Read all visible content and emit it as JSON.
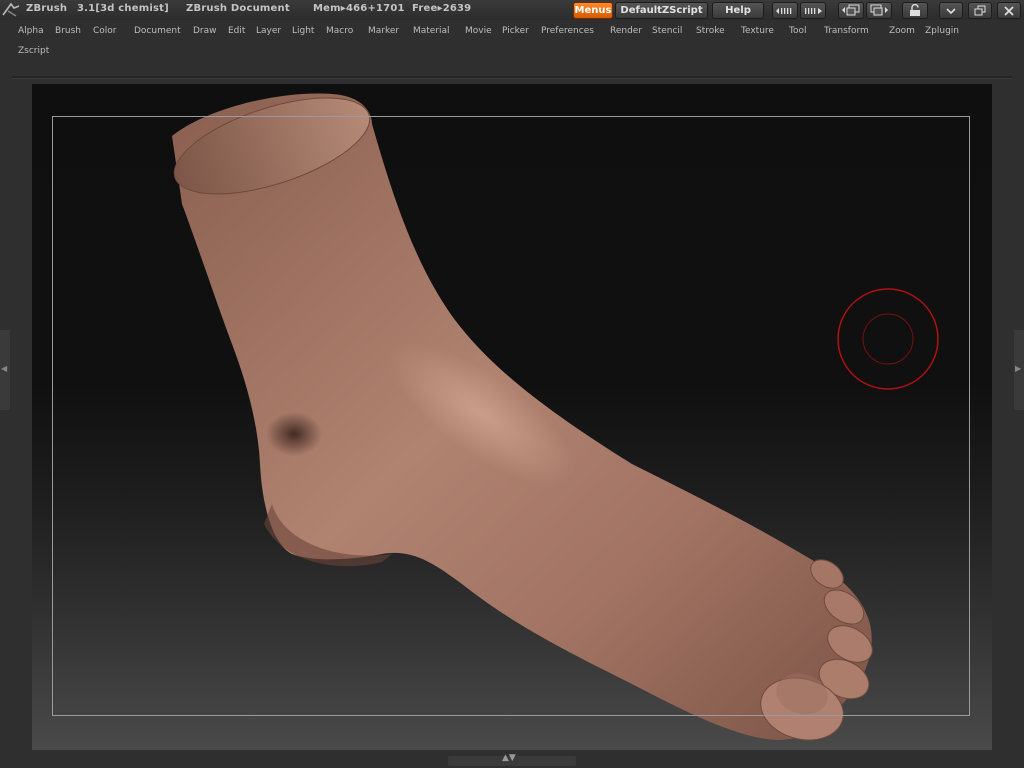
{
  "titlebar": {
    "app_name": "ZBrush",
    "version": "3.1[3d chemist]",
    "document": "ZBrush Document",
    "mem_label": "Mem▸466+1701",
    "free_label": "Free▸2639",
    "menus_btn": "Menus",
    "script_btn": "DefaultZScript",
    "help_btn": "Help"
  },
  "menu": {
    "items": [
      "Alpha",
      "Brush",
      "Color",
      "Document",
      "Draw",
      "Edit",
      "Layer",
      "Light",
      "Macro",
      "Marker",
      "Material",
      "Movie",
      "Picker",
      "Preferences",
      "Render",
      "Stencil",
      "Stroke",
      "Texture",
      "Tool",
      "Transform",
      "Zoom",
      "Zplugin",
      "Zscript"
    ]
  },
  "colors": {
    "accent": "#e86a0c",
    "skin": "#a47564",
    "brush_cursor": "#b01010",
    "background": "#2f2f2f"
  },
  "icons": [
    "zbrush-logo-icon",
    "palette-left-icon",
    "palette-right-icon",
    "layout-left-icon",
    "layout-right-icon",
    "lock-icon",
    "minimize-icon",
    "restore-icon",
    "close-icon"
  ]
}
